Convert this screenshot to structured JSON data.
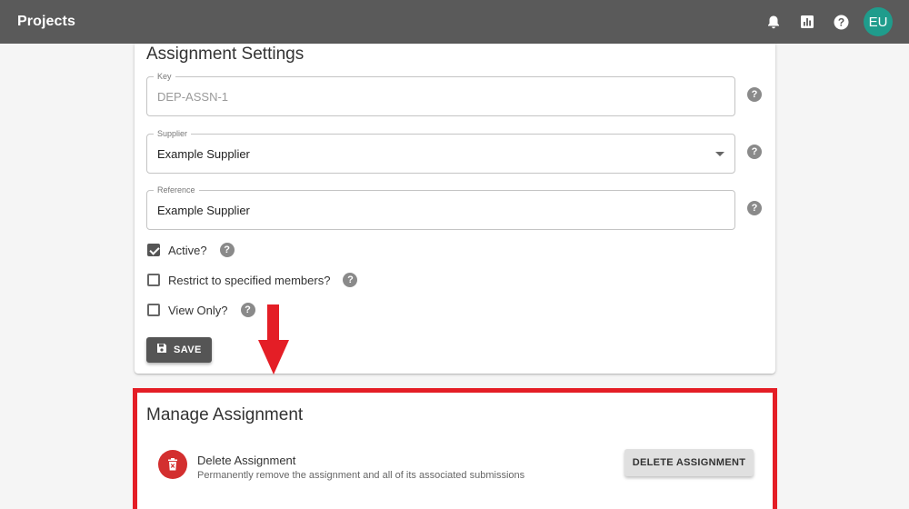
{
  "header": {
    "title": "Projects",
    "icons": [
      "bell-icon",
      "chart-icon",
      "help-icon"
    ],
    "avatar_initials": "EU",
    "avatar_color": "#1f9c8c",
    "bar_color": "#5a5a5a"
  },
  "settings": {
    "title": "Assignment Settings",
    "key": {
      "label": "Key",
      "value": "DEP-ASSN-1",
      "disabled": true
    },
    "supplier": {
      "label": "Supplier",
      "value": "Example Supplier"
    },
    "reference": {
      "label": "Reference",
      "value": "Example Supplier"
    },
    "help_glyph": "?",
    "checkboxes": [
      {
        "label": "Active?",
        "checked": true
      },
      {
        "label": "Restrict to specified members?",
        "checked": false
      },
      {
        "label": "View Only?",
        "checked": false
      }
    ],
    "save_label": "SAVE"
  },
  "manage": {
    "title": "Manage Assignment",
    "delete_title": "Delete Assignment",
    "delete_description": "Permanently remove the assignment and all of its associated submissions",
    "delete_button": "DELETE ASSIGNMENT",
    "highlight_color": "#e41e26",
    "delete_icon_color": "#d32f2f"
  }
}
